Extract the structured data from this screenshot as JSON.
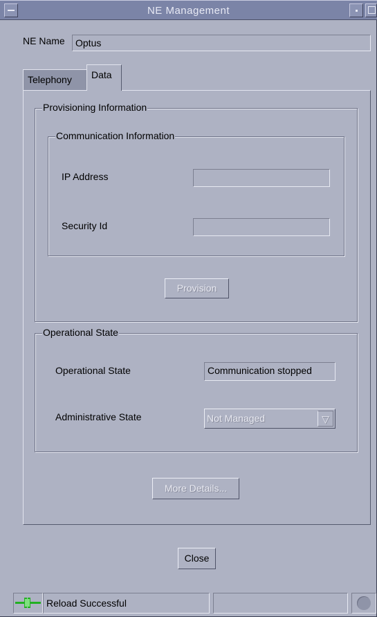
{
  "window": {
    "title": "NE Management"
  },
  "ne_name": {
    "label": "NE Name",
    "value": "Optus"
  },
  "tabs": [
    {
      "label": "Telephony",
      "active": false
    },
    {
      "label": "Data",
      "active": true
    }
  ],
  "provisioning": {
    "legend": "Provisioning Information",
    "communication": {
      "legend": "Communication Information",
      "ip_label": "IP Address",
      "ip_value": "",
      "security_label": "Security Id",
      "security_value": ""
    },
    "provision_button": "Provision"
  },
  "operational": {
    "legend": "Operational State",
    "op_state_label": "Operational State",
    "op_state_value": "Communication stopped",
    "admin_state_label": "Administrative State",
    "admin_state_value": "Not Managed"
  },
  "more_details_button": "More Details...",
  "close_button": "Close",
  "status": {
    "message": "Reload Successful"
  },
  "colors": {
    "window_bg": "#aeb2c3",
    "titlebar_bg": "#7b84a7",
    "plug_icon": "#22b022"
  },
  "icons": {
    "connection": "plug-icon",
    "busy": "busy-indicator-icon",
    "dropdown": "chevron-down-icon"
  }
}
